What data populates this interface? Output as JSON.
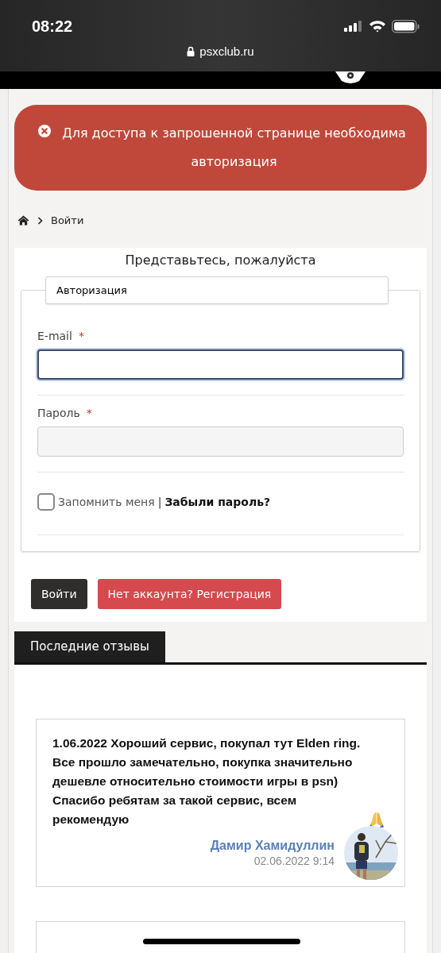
{
  "status_bar": {
    "time": "08:22",
    "url": "psxclub.ru"
  },
  "alert": {
    "kind": "error",
    "text": "Для доступа к запрошенной странице необходима авторизация"
  },
  "breadcrumb": {
    "items": [
      {
        "kind": "home"
      },
      {
        "kind": "text",
        "label": "Войти"
      }
    ]
  },
  "login": {
    "title": "Представьтесь, пожалуйста",
    "legend": "Авторизация",
    "required_mark": "*",
    "fields": [
      {
        "label": "E-mail",
        "required": true,
        "focused": true
      },
      {
        "label": "Пароль",
        "required": true,
        "focused": false
      }
    ],
    "remember": {
      "label": "Запомнить меня",
      "checked": false
    },
    "separator": "|",
    "forgot_link": "Забыли пароль?",
    "buttons": [
      {
        "label": "Войти",
        "kind": "primary"
      },
      {
        "label": "Нет аккаунта? Регистрация",
        "kind": "danger"
      }
    ]
  },
  "reviews": {
    "tab": "Последние отзывы",
    "items": [
      {
        "text": "1.06.2022 Хороший сервис, покупал тут Elden ring. Все прошло замечательно, покупка значительно дешевле относительно стоимости игры в psn) Спасибо ребятам за такой сервис, всем рекомендую",
        "author": "Дамир Хамидуллин",
        "date": "02.06.2022 9:14"
      }
    ]
  }
}
